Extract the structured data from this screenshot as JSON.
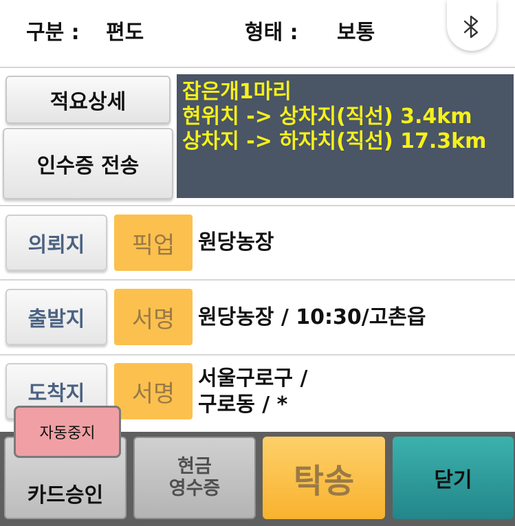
{
  "header": {
    "type_label": "구분 :",
    "type_value": "편도",
    "form_label": "형태 :",
    "form_value": "보통"
  },
  "buttons": {
    "detail": "적요상세",
    "receipt_send": "인수증 전송"
  },
  "info_lines": [
    "잡은개1마리",
    "현위치 -> 상차지(직선) 3.4km",
    "상차지 -> 하자치(직선) 17.3km"
  ],
  "rows": [
    {
      "label": "의뢰지",
      "action": "픽업",
      "text1": "원당농장",
      "text2": ""
    },
    {
      "label": "출발지",
      "action": "서명",
      "text1": "원당농장 / 10:30/고촌읍",
      "text2": ""
    },
    {
      "label": "도착지",
      "action": "서명",
      "text1": "서울구로구 /",
      "text2": "구로동 / *"
    }
  ],
  "auto_stop": "자동중지",
  "bottom": {
    "card": "카드승인",
    "cash_line1": "현금",
    "cash_line2": "영수증",
    "consign": "탁송",
    "close": "닫기"
  },
  "colors": {
    "info_bg": "#4a5565",
    "info_text": "#f5f01b",
    "orange": "#fcc04e",
    "teal": "#2f9e9a",
    "auto_stop_bg": "#f0a0a4"
  }
}
